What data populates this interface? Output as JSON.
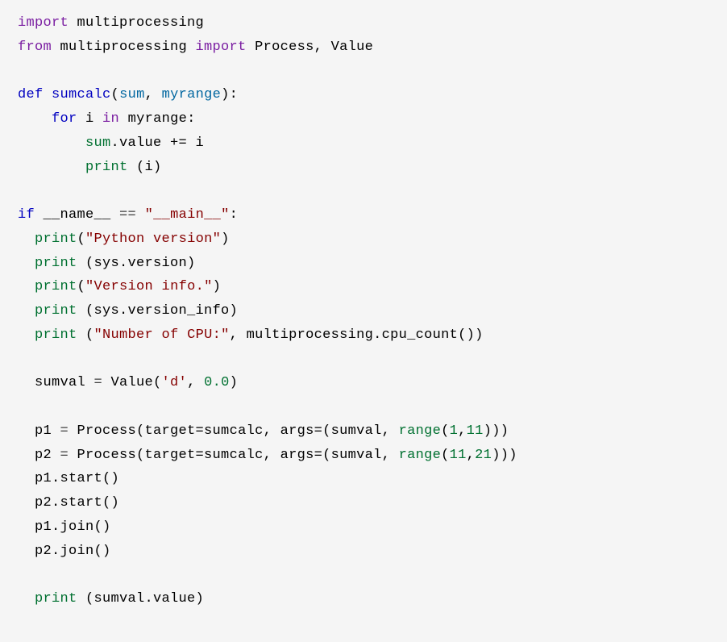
{
  "code": {
    "l01": {
      "a": "import",
      "b": " multiprocessing"
    },
    "l02": {
      "a": "from",
      "b": " multiprocessing ",
      "c": "import",
      "d": " Process, Value"
    },
    "l04": {
      "a": "def",
      "b": " ",
      "c": "sumcalc",
      "d": "(",
      "e": "sum",
      "f": ", ",
      "g": "myrange",
      "h": "):"
    },
    "l05": {
      "a": "    ",
      "b": "for",
      "c": " i ",
      "d": "in",
      "e": " myrange:"
    },
    "l06": {
      "a": "        ",
      "b": "sum",
      "c": ".value += i"
    },
    "l07": {
      "a": "        ",
      "b": "print",
      "c": " (i)"
    },
    "l09": {
      "a": "if",
      "b": " __name__ ",
      "c": "==",
      "d": " ",
      "e": "\"__main__\"",
      "f": ":"
    },
    "l10": {
      "a": "  ",
      "b": "print",
      "c": "(",
      "d": "\"Python version\"",
      "e": ")"
    },
    "l11": {
      "a": "  ",
      "b": "print",
      "c": " (sys.version)"
    },
    "l12": {
      "a": "  ",
      "b": "print",
      "c": "(",
      "d": "\"Version info.\"",
      "e": ")"
    },
    "l13": {
      "a": "  ",
      "b": "print",
      "c": " (sys.version_info)"
    },
    "l14": {
      "a": "  ",
      "b": "print",
      "c": " (",
      "d": "\"Number of CPU:\"",
      "e": ", multiprocessing.cpu_count())"
    },
    "l16": {
      "a": "  sumval ",
      "b": "=",
      "c": " Value(",
      "d": "'d'",
      "e": ", ",
      "f": "0.0",
      "g": ")"
    },
    "l18": {
      "a": "  p1 ",
      "b": "=",
      "c": " Process(target=sumcalc, args=(sumval, ",
      "d": "range",
      "e": "(",
      "f": "1",
      "g": ",",
      "h": "11",
      "i": ")))"
    },
    "l19": {
      "a": "  p2 ",
      "b": "=",
      "c": " Process(target=sumcalc, args=(sumval, ",
      "d": "range",
      "e": "(",
      "f": "11",
      "g": ",",
      "h": "21",
      "i": ")))"
    },
    "l20": {
      "a": "  p1.start()"
    },
    "l21": {
      "a": "  p2.start()"
    },
    "l22": {
      "a": "  p1.join()"
    },
    "l23": {
      "a": "  p2.join()"
    },
    "l25": {
      "a": "  ",
      "b": "print",
      "c": " (sumval.value)"
    }
  }
}
